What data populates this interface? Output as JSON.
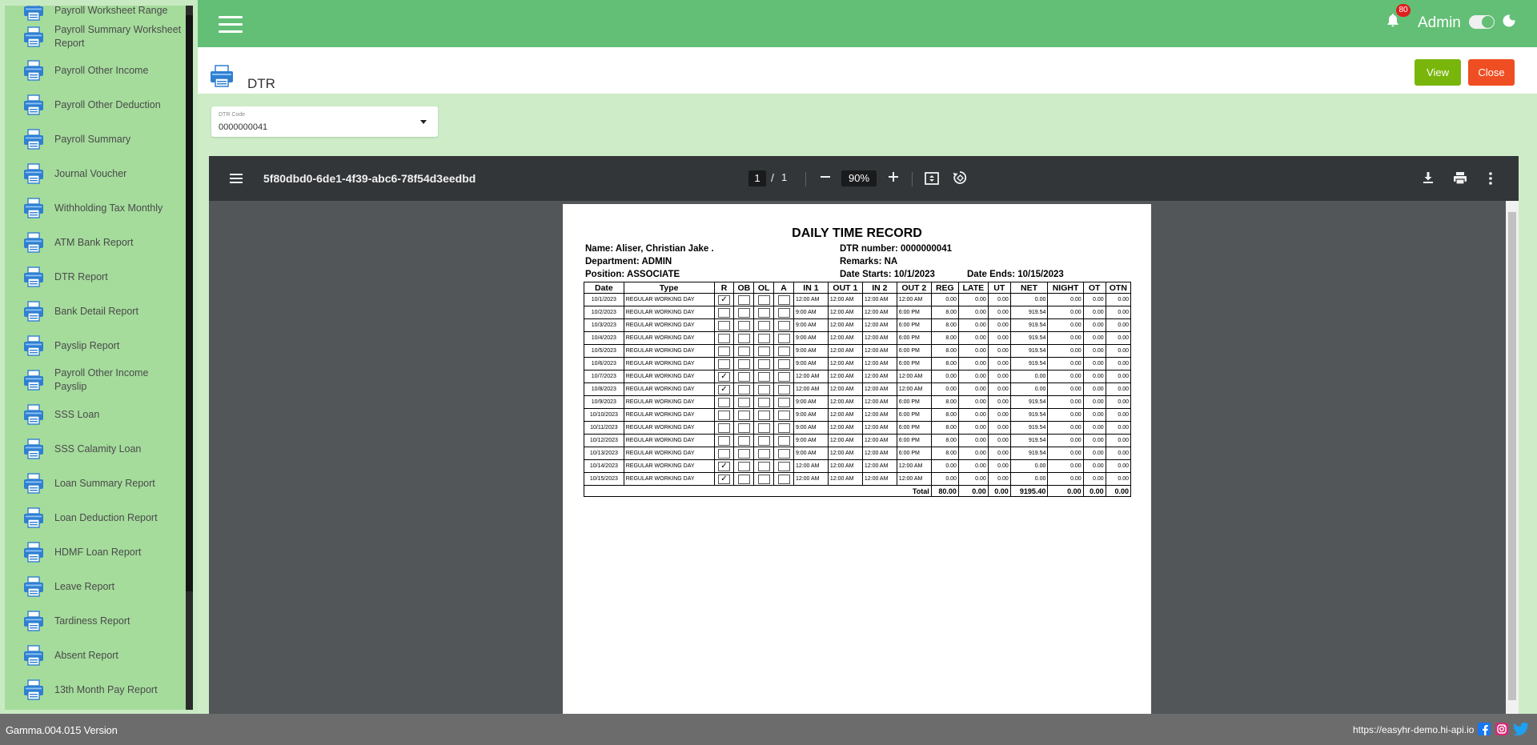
{
  "sidebar": {
    "items": [
      {
        "label": "Payroll Worksheet Range"
      },
      {
        "label": "Payroll Summary Worksheet Report"
      },
      {
        "label": "Payroll Other Income"
      },
      {
        "label": "Payroll Other Deduction"
      },
      {
        "label": "Payroll Summary"
      },
      {
        "label": "Journal Voucher"
      },
      {
        "label": "Withholding Tax Monthly"
      },
      {
        "label": "ATM Bank Report"
      },
      {
        "label": "DTR Report"
      },
      {
        "label": "Bank Detail Report"
      },
      {
        "label": "Payslip Report"
      },
      {
        "label": "Payroll Other Income Payslip"
      },
      {
        "label": "SSS Loan"
      },
      {
        "label": "SSS Calamity Loan"
      },
      {
        "label": "Loan Summary Report"
      },
      {
        "label": "Loan Deduction Report"
      },
      {
        "label": "HDMF Loan Report"
      },
      {
        "label": "Leave Report"
      },
      {
        "label": "Tardiness Report"
      },
      {
        "label": "Absent Report"
      },
      {
        "label": "13th Month Pay Report"
      }
    ]
  },
  "header": {
    "notification_count": "80",
    "user_name": "Admin",
    "colors": {
      "topbar": "#62bf75",
      "badge": "#e01e1e"
    }
  },
  "page": {
    "title": "DTR",
    "view_label": "View",
    "close_label": "Close",
    "colors": {
      "view": "#79b60c",
      "close": "#ef4e23"
    }
  },
  "filter": {
    "dtr_code_label": "DTR Code",
    "dtr_code_value": "0000000041"
  },
  "viewer": {
    "doc_title": "5f80dbd0-6de1-4f39-abc6-78f54d3eedbd",
    "page_current": "1",
    "page_sep": "/",
    "page_total": "1",
    "zoom": "90%"
  },
  "report": {
    "heading": "DAILY TIME RECORD",
    "name": "Name: Aliser, Christian Jake .",
    "department": "Department: ADMIN",
    "position": "Position: ASSOCIATE",
    "dtr_number": "DTR number: 0000000041",
    "remarks": "Remarks: NA",
    "date_starts": "Date Starts: 10/1/2023",
    "date_ends": "Date Ends: 10/15/2023",
    "columns": [
      "Date",
      "Type",
      "R",
      "OB",
      "OL",
      "A",
      "IN 1",
      "OUT 1",
      "IN 2",
      "OUT 2",
      "REG",
      "LATE",
      "UT",
      "NET",
      "NIGHT",
      "OT",
      "OTN"
    ],
    "rows": [
      {
        "date": "10/1/2023",
        "type": "REGULAR WORKING DAY",
        "r": "✓",
        "in1": "12:00 AM",
        "out1": "12:00 AM",
        "in2": "12:00 AM",
        "out2": "12:00 AM",
        "reg": "0.00",
        "late": "0.00",
        "ut": "0.00",
        "net": "0.00",
        "night": "0.00",
        "ot": "0.00",
        "otn": "0.00"
      },
      {
        "date": "10/2/2023",
        "type": "REGULAR WORKING DAY",
        "r": "",
        "in1": "9:00 AM",
        "out1": "12:00 AM",
        "in2": "12:00 AM",
        "out2": "6:00 PM",
        "reg": "8.00",
        "late": "0.00",
        "ut": "0.00",
        "net": "919.54",
        "night": "0.00",
        "ot": "0.00",
        "otn": "0.00"
      },
      {
        "date": "10/3/2023",
        "type": "REGULAR WORKING DAY",
        "r": "",
        "in1": "9:00 AM",
        "out1": "12:00 AM",
        "in2": "12:00 AM",
        "out2": "6:00 PM",
        "reg": "8.00",
        "late": "0.00",
        "ut": "0.00",
        "net": "919.54",
        "night": "0.00",
        "ot": "0.00",
        "otn": "0.00"
      },
      {
        "date": "10/4/2023",
        "type": "REGULAR WORKING DAY",
        "r": "",
        "in1": "9:00 AM",
        "out1": "12:00 AM",
        "in2": "12:00 AM",
        "out2": "6:00 PM",
        "reg": "8.00",
        "late": "0.00",
        "ut": "0.00",
        "net": "919.54",
        "night": "0.00",
        "ot": "0.00",
        "otn": "0.00"
      },
      {
        "date": "10/5/2023",
        "type": "REGULAR WORKING DAY",
        "r": "",
        "in1": "9:00 AM",
        "out1": "12:00 AM",
        "in2": "12:00 AM",
        "out2": "6:00 PM",
        "reg": "8.00",
        "late": "0.00",
        "ut": "0.00",
        "net": "919.54",
        "night": "0.00",
        "ot": "0.00",
        "otn": "0.00"
      },
      {
        "date": "10/6/2023",
        "type": "REGULAR WORKING DAY",
        "r": "",
        "in1": "9:00 AM",
        "out1": "12:00 AM",
        "in2": "12:00 AM",
        "out2": "6:00 PM",
        "reg": "8.00",
        "late": "0.00",
        "ut": "0.00",
        "net": "919.54",
        "night": "0.00",
        "ot": "0.00",
        "otn": "0.00"
      },
      {
        "date": "10/7/2023",
        "type": "REGULAR WORKING DAY",
        "r": "✓",
        "in1": "12:00 AM",
        "out1": "12:00 AM",
        "in2": "12:00 AM",
        "out2": "12:00 AM",
        "reg": "0.00",
        "late": "0.00",
        "ut": "0.00",
        "net": "0.00",
        "night": "0.00",
        "ot": "0.00",
        "otn": "0.00"
      },
      {
        "date": "10/8/2023",
        "type": "REGULAR WORKING DAY",
        "r": "✓",
        "in1": "12:00 AM",
        "out1": "12:00 AM",
        "in2": "12:00 AM",
        "out2": "12:00 AM",
        "reg": "0.00",
        "late": "0.00",
        "ut": "0.00",
        "net": "0.00",
        "night": "0.00",
        "ot": "0.00",
        "otn": "0.00"
      },
      {
        "date": "10/9/2023",
        "type": "REGULAR WORKING DAY",
        "r": "",
        "in1": "9:00 AM",
        "out1": "12:00 AM",
        "in2": "12:00 AM",
        "out2": "6:00 PM",
        "reg": "8.00",
        "late": "0.00",
        "ut": "0.00",
        "net": "919.54",
        "night": "0.00",
        "ot": "0.00",
        "otn": "0.00"
      },
      {
        "date": "10/10/2023",
        "type": "REGULAR WORKING DAY",
        "r": "",
        "in1": "9:00 AM",
        "out1": "12:00 AM",
        "in2": "12:00 AM",
        "out2": "6:00 PM",
        "reg": "8.00",
        "late": "0.00",
        "ut": "0.00",
        "net": "919.54",
        "night": "0.00",
        "ot": "0.00",
        "otn": "0.00"
      },
      {
        "date": "10/11/2023",
        "type": "REGULAR WORKING DAY",
        "r": "",
        "in1": "9:00 AM",
        "out1": "12:00 AM",
        "in2": "12:00 AM",
        "out2": "6:00 PM",
        "reg": "8.00",
        "late": "0.00",
        "ut": "0.00",
        "net": "919.54",
        "night": "0.00",
        "ot": "0.00",
        "otn": "0.00"
      },
      {
        "date": "10/12/2023",
        "type": "REGULAR WORKING DAY",
        "r": "",
        "in1": "9:00 AM",
        "out1": "12:00 AM",
        "in2": "12:00 AM",
        "out2": "6:00 PM",
        "reg": "8.00",
        "late": "0.00",
        "ut": "0.00",
        "net": "919.54",
        "night": "0.00",
        "ot": "0.00",
        "otn": "0.00"
      },
      {
        "date": "10/13/2023",
        "type": "REGULAR WORKING DAY",
        "r": "",
        "in1": "9:00 AM",
        "out1": "12:00 AM",
        "in2": "12:00 AM",
        "out2": "6:00 PM",
        "reg": "8.00",
        "late": "0.00",
        "ut": "0.00",
        "net": "919.54",
        "night": "0.00",
        "ot": "0.00",
        "otn": "0.00"
      },
      {
        "date": "10/14/2023",
        "type": "REGULAR WORKING DAY",
        "r": "✓",
        "in1": "12:00 AM",
        "out1": "12:00 AM",
        "in2": "12:00 AM",
        "out2": "12:00 AM",
        "reg": "0.00",
        "late": "0.00",
        "ut": "0.00",
        "net": "0.00",
        "night": "0.00",
        "ot": "0.00",
        "otn": "0.00"
      },
      {
        "date": "10/15/2023",
        "type": "REGULAR WORKING DAY",
        "r": "✓",
        "in1": "12:00 AM",
        "out1": "12:00 AM",
        "in2": "12:00 AM",
        "out2": "12:00 AM",
        "reg": "0.00",
        "late": "0.00",
        "ut": "0.00",
        "net": "0.00",
        "night": "0.00",
        "ot": "0.00",
        "otn": "0.00"
      }
    ],
    "total": {
      "label": "Total",
      "reg": "80.00",
      "late": "0.00",
      "ut": "0.00",
      "net": "9195.40",
      "night": "0.00",
      "ot": "0.00",
      "otn": "0.00"
    }
  },
  "footer": {
    "version": "Gamma.004.015 Version",
    "url": "https://easyhr-demo.hi-api.io"
  }
}
